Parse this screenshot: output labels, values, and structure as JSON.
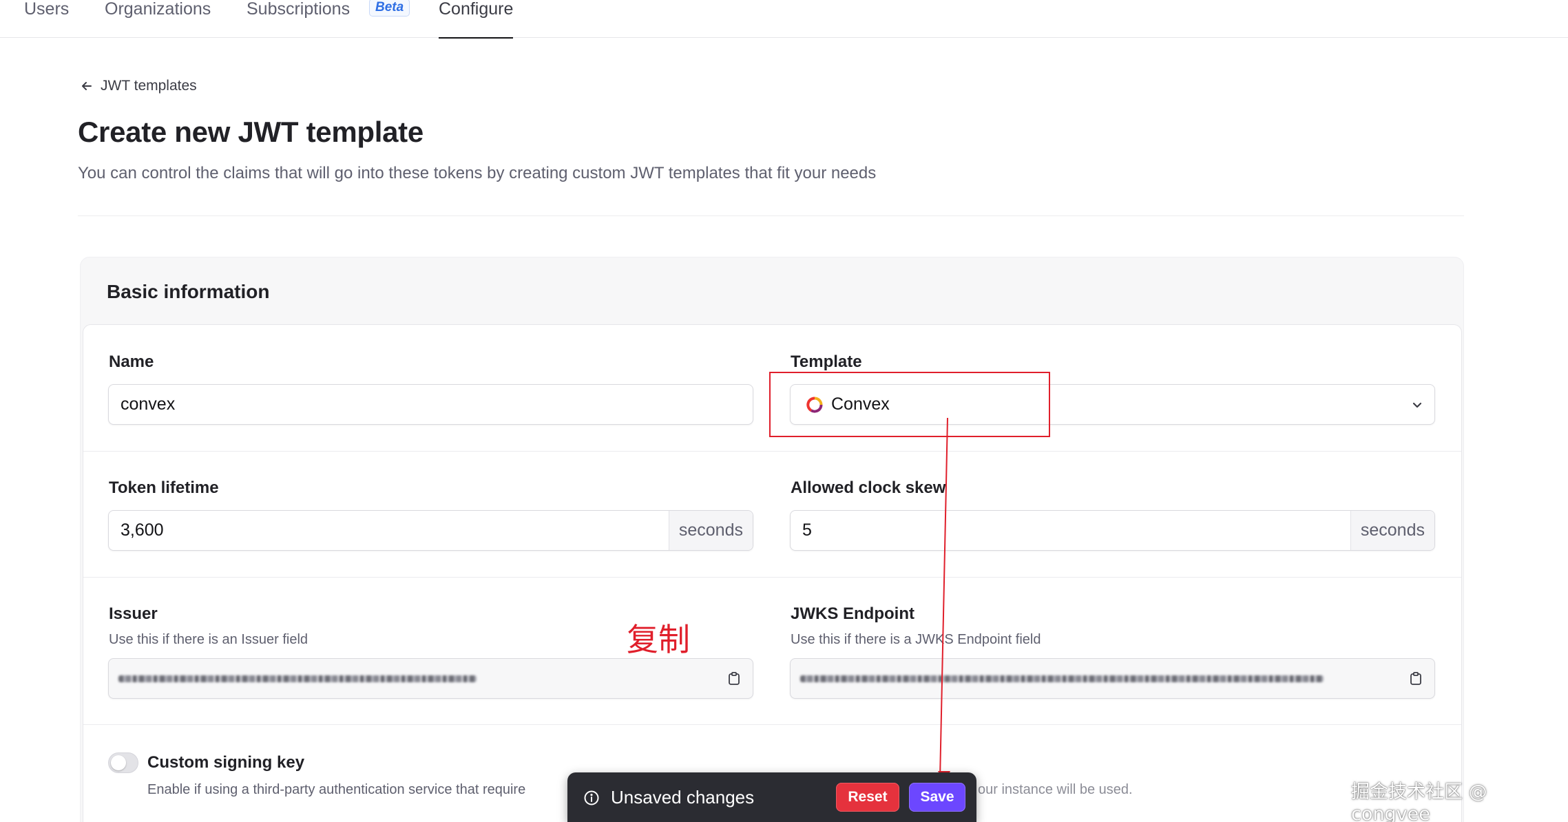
{
  "nav": {
    "tabs": [
      {
        "label": "Users"
      },
      {
        "label": "Organizations"
      },
      {
        "label": "Subscriptions",
        "badge": "Beta"
      },
      {
        "label": "Configure",
        "active": true
      }
    ]
  },
  "breadcrumb": {
    "back_label": "JWT templates"
  },
  "page": {
    "title": "Create new JWT template",
    "subtitle": "You can control the claims that will go into these tokens by creating custom JWT templates that fit your needs"
  },
  "basic_info": {
    "section_title": "Basic information",
    "name": {
      "label": "Name",
      "value": "convex"
    },
    "template": {
      "label": "Template",
      "value": "Convex"
    },
    "token_lifetime": {
      "label": "Token lifetime",
      "value": "3,600",
      "suffix": "seconds"
    },
    "clock_skew": {
      "label": "Allowed clock skew",
      "value": "5",
      "suffix": "seconds"
    },
    "issuer": {
      "label": "Issuer",
      "hint": "Use this if there is an Issuer field"
    },
    "jwks": {
      "label": "JWKS Endpoint",
      "hint": "Use this if there is a JWKS Endpoint field"
    },
    "signing_key": {
      "label": "Custom signing key",
      "hint": "Enable if using a third-party authentication service that require",
      "hint_tail": "our instance will be used.",
      "enabled": false
    }
  },
  "annotation": {
    "note": "复制",
    "color": "#e01f2b"
  },
  "unsaved_bar": {
    "text": "Unsaved changes",
    "reset_label": "Reset",
    "save_label": "Save"
  },
  "watermark": "掘金技术社区 @ congvee",
  "colors": {
    "accent": "#6c47ff",
    "danger": "#e5323d",
    "annotation": "#e01f2b"
  },
  "icons": [
    "arrow-left-icon",
    "convex-logo-icon",
    "chevron-down-icon",
    "clipboard-icon",
    "info-icon"
  ]
}
